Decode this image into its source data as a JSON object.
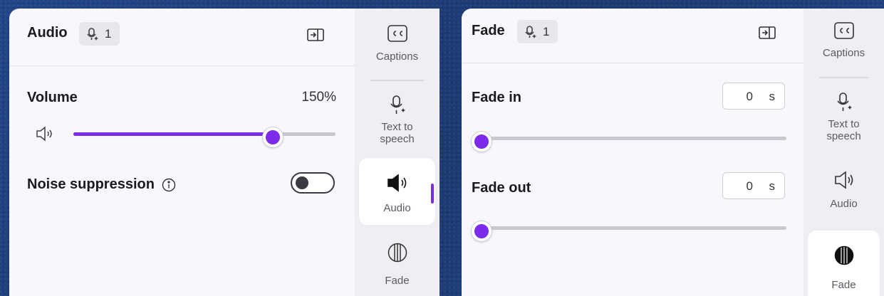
{
  "audio_panel": {
    "title": "Audio",
    "badge_count": "1",
    "volume": {
      "label": "Volume",
      "value_text": "150%",
      "level": 0.75
    },
    "noise_suppression": {
      "label": "Noise suppression",
      "enabled": false
    }
  },
  "fade_panel": {
    "title": "Fade",
    "badge_count": "1",
    "fade_in": {
      "label": "Fade in",
      "value": "0",
      "unit": "s",
      "level": 0
    },
    "fade_out": {
      "label": "Fade out",
      "value": "0",
      "unit": "s",
      "level": 0
    }
  },
  "rail": {
    "captions": "Captions",
    "tts_line1": "Text to",
    "tts_line2": "speech",
    "audio": "Audio",
    "fade": "Fade"
  },
  "colors": {
    "accent": "#7c2bea",
    "panel_bg": "#f8f7fb",
    "rail_bg": "#efeef3"
  },
  "icons": [
    "voice-badge-icon",
    "dock-panel-icon",
    "speaker-icon",
    "info-icon",
    "captions-icon",
    "text-to-speech-icon",
    "audio-icon",
    "fade-icon"
  ]
}
